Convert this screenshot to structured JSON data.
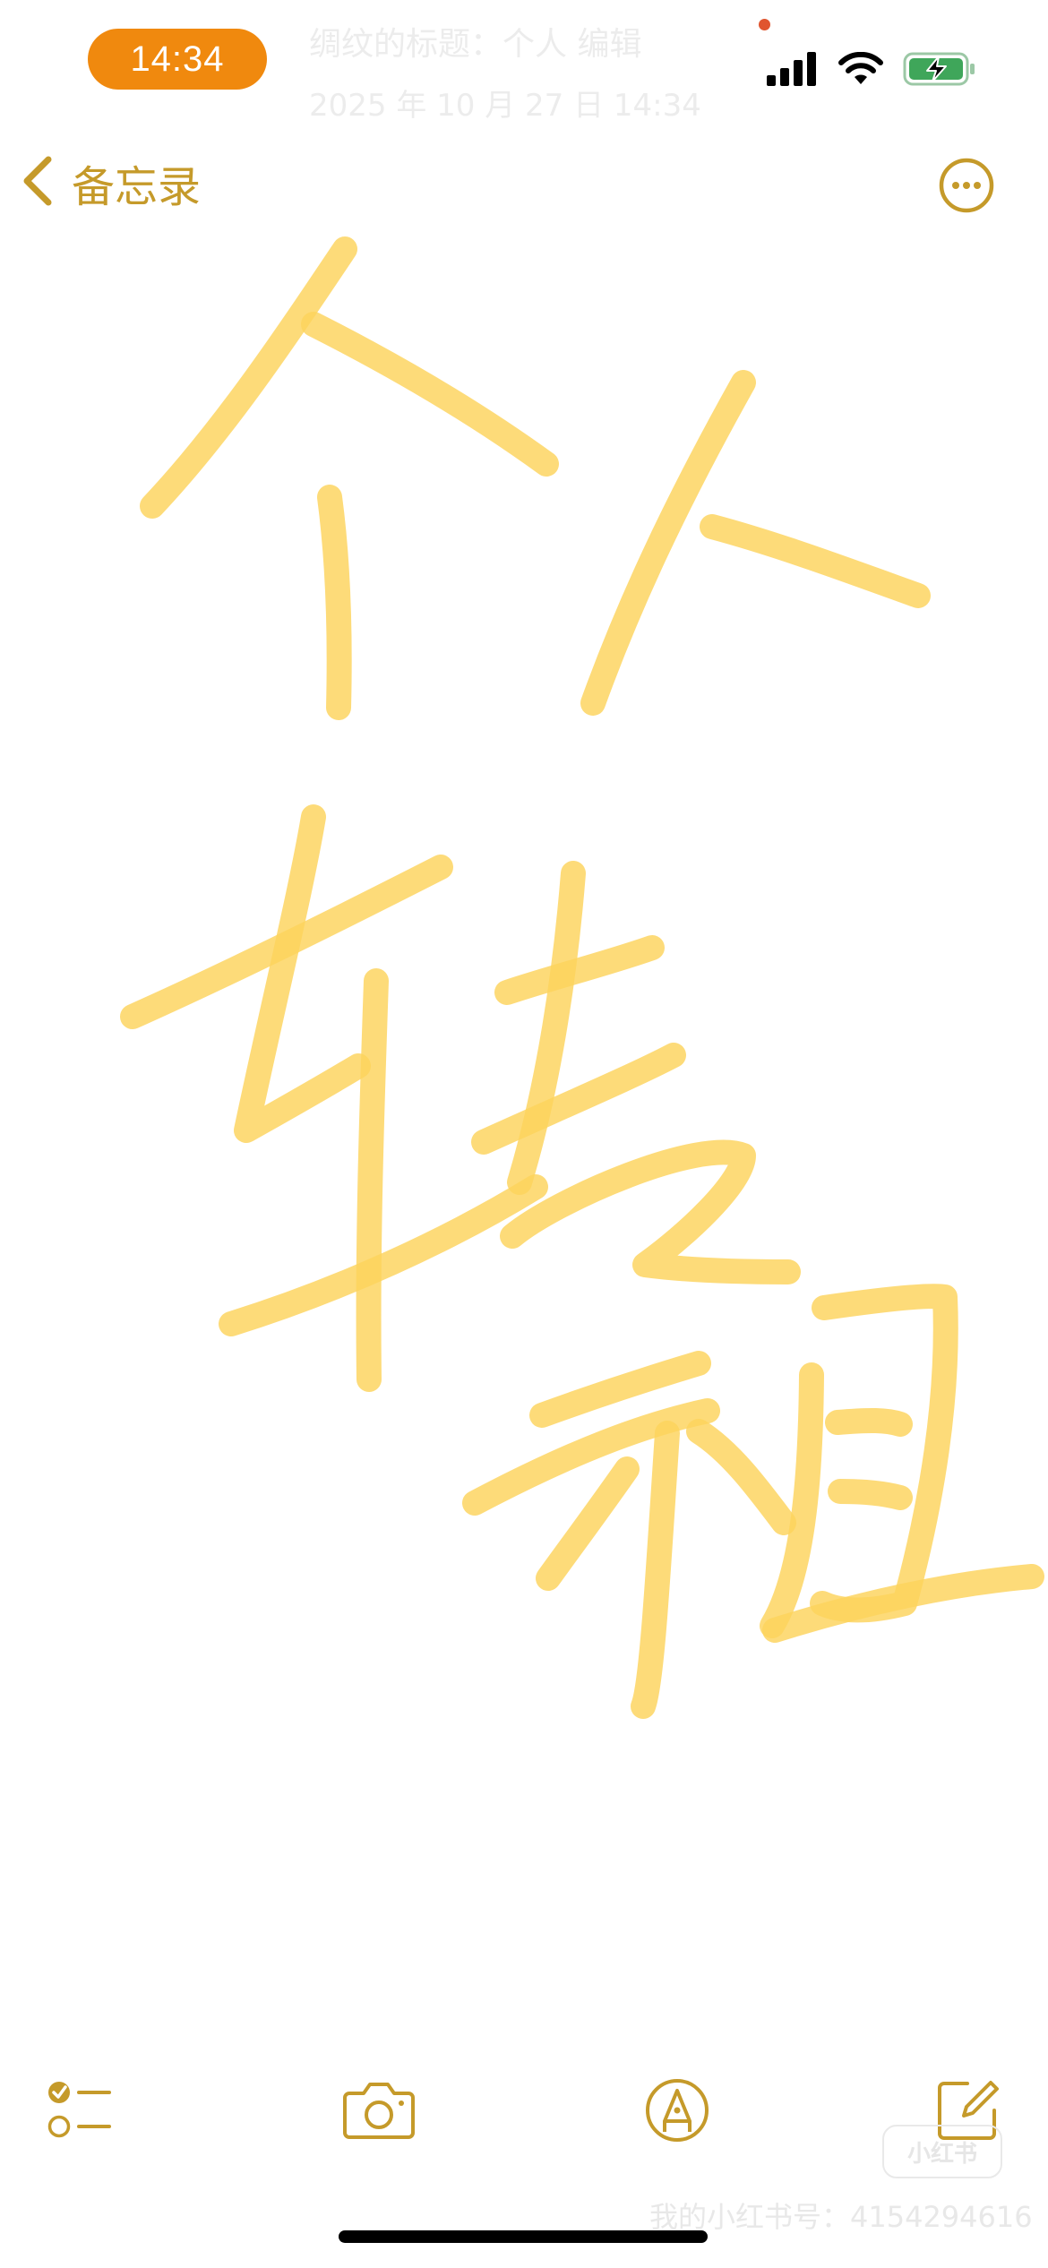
{
  "status_bar": {
    "time": "14:34",
    "ghost_title": "绸纹的标题：个人  编辑",
    "ghost_date": "2025 年 10 月 27 日 14:34",
    "signal_icon": "cellular-signal-icon",
    "wifi_icon": "wifi-icon",
    "battery_icon": "battery-charging-icon",
    "time_pill_color": "#f0890e",
    "battery_color": "#3fa65a"
  },
  "nav": {
    "back_label": "备忘录",
    "back_icon": "chevron-left-icon",
    "more_icon": "ellipsis-circle-icon",
    "accent_color": "#c59a2a"
  },
  "drawing": {
    "description_icon": "handwritten-ink-drawing",
    "ink_color": "#fcd35c"
  },
  "toolbar": {
    "checklist_icon": "checklist-icon",
    "camera_icon": "camera-icon",
    "markup_icon": "markup-pen-icon",
    "compose_icon": "compose-icon"
  },
  "watermark": {
    "badge": "小红书",
    "text": "我的小红书号：4154294616"
  }
}
